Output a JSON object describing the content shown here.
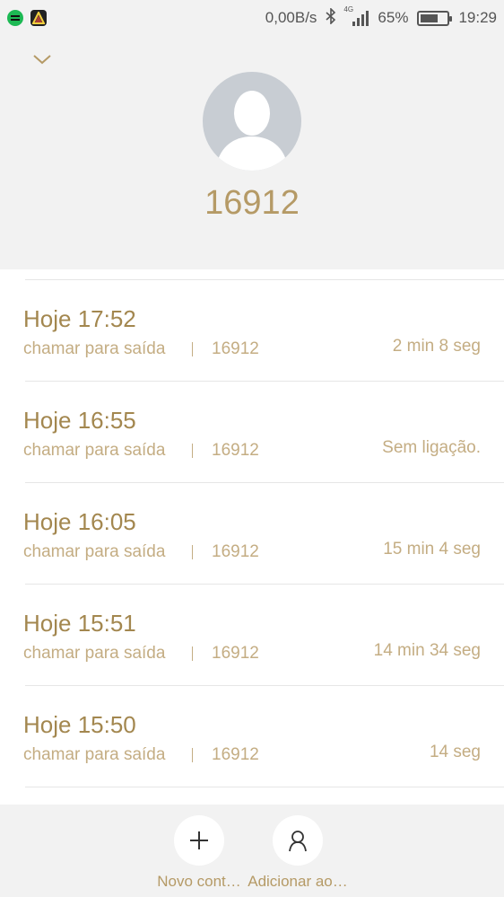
{
  "status_bar": {
    "network_speed": "0,00B/s",
    "signal_label": "4G",
    "battery_percent": "65%",
    "battery_level": 0.65,
    "time": "19:29",
    "icons": [
      "spotify-icon",
      "prism-icon",
      "bluetooth-icon",
      "signal-icon",
      "battery-icon"
    ]
  },
  "contact": {
    "number": "16912"
  },
  "calls": [
    {
      "time": "Hoje 17:52",
      "type": "chamar para saída",
      "number": "16912",
      "duration": "2 min 8 seg"
    },
    {
      "time": "Hoje 16:55",
      "type": "chamar para saída",
      "number": "16912",
      "duration": "Sem ligação."
    },
    {
      "time": "Hoje 16:05",
      "type": "chamar para saída",
      "number": "16912",
      "duration": "15 min 4 seg"
    },
    {
      "time": "Hoje 15:51",
      "type": "chamar para saída",
      "number": "16912",
      "duration": "14 min 34 seg"
    },
    {
      "time": "Hoje 15:50",
      "type": "chamar para saída",
      "number": "16912",
      "duration": "14 seg"
    }
  ],
  "actions": {
    "new_contact_label": "Novo cont…",
    "add_to_label": "Adicionar ao…"
  },
  "colors": {
    "accent": "#b59a66",
    "accent_light": "#c4ad83",
    "background": "#f2f2f2"
  }
}
